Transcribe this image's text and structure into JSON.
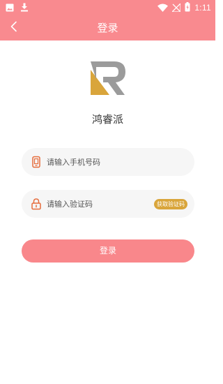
{
  "status_bar": {
    "time": "1:11",
    "icons": [
      "image-icon",
      "download-icon",
      "wifi-icon",
      "no-signal-icon",
      "battery-charging-icon"
    ]
  },
  "navbar": {
    "title": "登录",
    "back_icon": "chevron-left-icon"
  },
  "app": {
    "name": "鸿睿派",
    "logo_icon": "logo-r-icon"
  },
  "form": {
    "phone": {
      "placeholder": "请输入手机号码",
      "value": "",
      "icon": "phone-icon"
    },
    "code": {
      "placeholder": "请输入验证码",
      "value": "",
      "icon": "lock-icon",
      "get_code_label": "获取验证码"
    },
    "login_label": "登录"
  },
  "colors": {
    "primary": "#f98a8f",
    "login_button": "#f9878b",
    "code_button": "#d9a53b",
    "icon_orange": "#e56c3c",
    "logo_gold": "#d9a53b",
    "logo_gray": "#9b9b9b"
  }
}
